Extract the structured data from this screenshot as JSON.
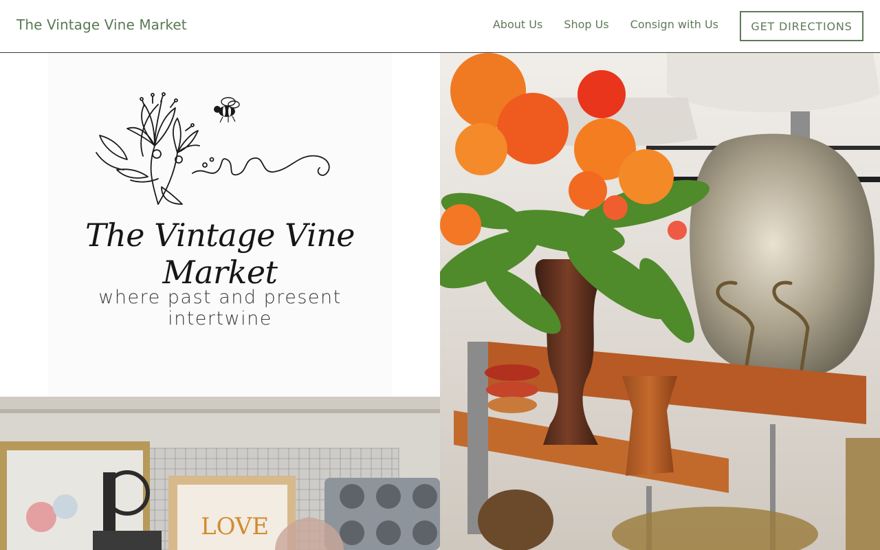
{
  "header": {
    "site_title": "The Vintage Vine Market",
    "nav": [
      {
        "label": "About Us"
      },
      {
        "label": "Shop Us"
      },
      {
        "label": "Consign with Us"
      }
    ],
    "cta_label": "GET DIRECTIONS"
  },
  "logo": {
    "name": "The Vintage Vine Market",
    "tagline": "where past and present intertwine"
  },
  "colors": {
    "accent": "#5f7a58",
    "header_border": "#3b3b3b",
    "logo_bg": "#fbfbfc"
  },
  "images": {
    "right_photo": "bouquet-of-orange-poppies-and-ferns-in-bronze-vase-with-mercury-glass-lamp",
    "bottom_photo": "vintage-shop-wall-with-grinder-framed-art-and-muffin-tin"
  }
}
